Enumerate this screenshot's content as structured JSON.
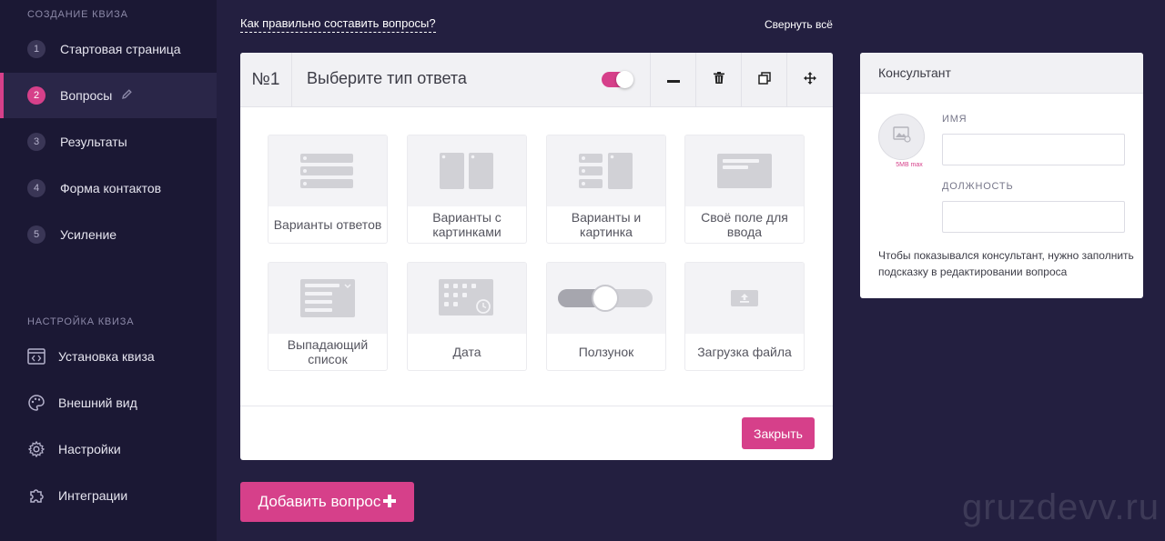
{
  "sidebar": {
    "section_create": "Создание квиза",
    "steps": [
      {
        "num": "1",
        "label": "Стартовая страница"
      },
      {
        "num": "2",
        "label": "Вопросы"
      },
      {
        "num": "3",
        "label": "Результаты"
      },
      {
        "num": "4",
        "label": "Форма контактов"
      },
      {
        "num": "5",
        "label": "Усиление"
      }
    ],
    "section_settings": "Настройка квиза",
    "settings_items": [
      {
        "label": "Установка квиза",
        "icon": "code-window-icon"
      },
      {
        "label": "Внешний вид",
        "icon": "palette-icon"
      },
      {
        "label": "Настройки",
        "icon": "gear-icon"
      },
      {
        "label": "Интеграции",
        "icon": "puzzle-icon"
      }
    ]
  },
  "top": {
    "help_link": "Как правильно составить вопросы?",
    "collapse_all": "Свернуть всё"
  },
  "question": {
    "number": "№1",
    "title": "Выберите тип ответа",
    "toggle_on": true,
    "types": [
      {
        "label": "Варианты ответов",
        "icon": "list-options-icon"
      },
      {
        "label": "Варианты с картинками",
        "icon": "image-cards-icon"
      },
      {
        "label": "Варианты и картинка",
        "icon": "list-and-image-icon"
      },
      {
        "label": "Своё поле для ввода",
        "icon": "text-field-icon"
      },
      {
        "label": "Выпадающий список",
        "icon": "dropdown-icon"
      },
      {
        "label": "Дата",
        "icon": "calendar-icon"
      },
      {
        "label": "Ползунок",
        "icon": "slider-icon"
      },
      {
        "label": "Загрузка файла",
        "icon": "upload-icon"
      }
    ],
    "close_label": "Закрыть"
  },
  "add_question_label": "Добавить вопрос",
  "consultant": {
    "title": "Консультант",
    "avatar_max": "5MB max",
    "name_label": "Имя",
    "position_label": "Должность",
    "note": "Чтобы показывался консультант, нужно заполнить подсказку в редактировании вопроса"
  },
  "watermark": "gruzdevv.ru",
  "colors": {
    "accent": "#d6408a",
    "background": "#231f40",
    "sidebar": "#1b1834"
  }
}
